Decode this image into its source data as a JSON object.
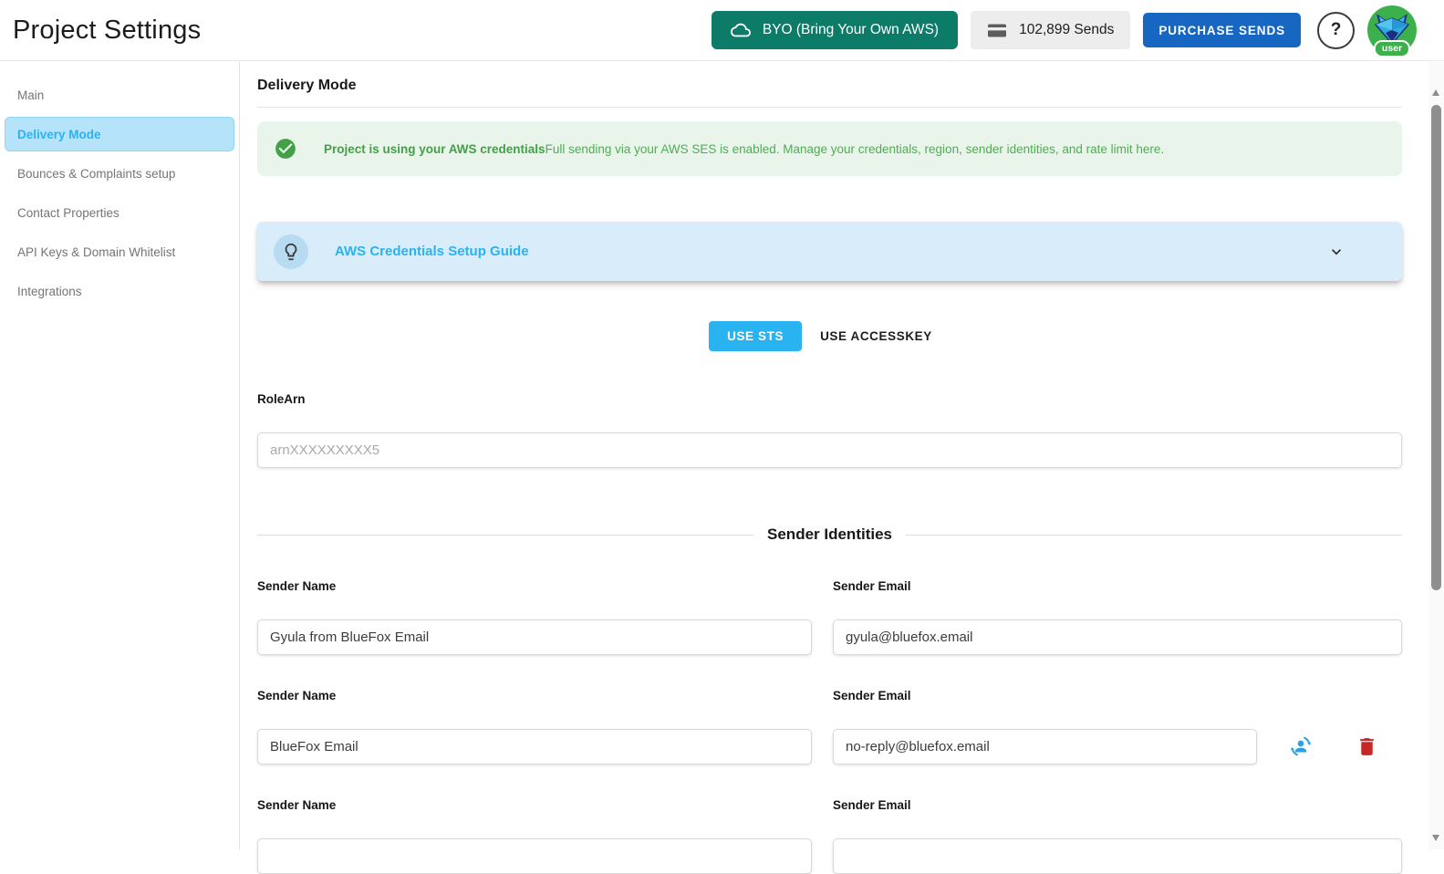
{
  "header": {
    "title": "Project Settings",
    "byo_button": {
      "label": "BYO (Bring Your Own AWS)",
      "icon": "cloud-icon",
      "color": "#0c7b68"
    },
    "sends_chip": {
      "label": "102,899 Sends",
      "icon": "credit-card-icon"
    },
    "purchase_button": {
      "label": "PURCHASE SENDS",
      "color": "#1766c2"
    },
    "help_button": {
      "label": "?"
    },
    "avatar": {
      "icon": "bluefox-logo",
      "badge": "user"
    }
  },
  "sidebar": {
    "items": [
      {
        "label": "Main",
        "active": false
      },
      {
        "label": "Delivery Mode",
        "active": true
      },
      {
        "label": "Bounces & Complaints setup",
        "active": false
      },
      {
        "label": "Contact Properties",
        "active": false
      },
      {
        "label": "API Keys & Domain Whitelist",
        "active": false
      },
      {
        "label": "Integrations",
        "active": false
      }
    ]
  },
  "main": {
    "heading": "Delivery Mode",
    "status_alert": {
      "icon": "check-circle-icon",
      "title": "Project is using your AWS credentials",
      "body": "Full sending via your AWS SES is enabled. Manage your credentials, region, sender identities, and rate limit here.",
      "color": "#4caf50"
    },
    "setup_guide": {
      "icon": "lightbulb-icon",
      "title": "AWS Credentials Setup Guide",
      "chevron": "chevron-down-icon"
    },
    "credential_tabs": [
      {
        "label": "USE STS",
        "active": true
      },
      {
        "label": "USE ACCESSKEY",
        "active": false
      }
    ],
    "role_arn": {
      "label": "RoleArn",
      "value": "",
      "placeholder": "arnXXXXXXXXX5"
    },
    "sender_identities": {
      "heading": "Sender Identities",
      "name_label": "Sender Name",
      "email_label": "Sender Email",
      "rows": [
        {
          "name": "Gyula from BlueFox Email",
          "email": "gyula@bluefox.email"
        },
        {
          "name": "BlueFox Email",
          "email": "no-reply@bluefox.email",
          "actions": [
            "sync-sender-icon",
            "delete-sender-icon"
          ]
        },
        {
          "name": "",
          "email": ""
        }
      ]
    }
  },
  "colors": {
    "accent_blue": "#29b3f1",
    "sidebar_active_bg": "#b5e3f9",
    "success_green": "#4caf50",
    "alert_bg": "#e9f5eb",
    "guide_bg": "#d8ecf9",
    "byo_teal": "#0c7b68",
    "purchase_blue": "#1766c2",
    "delete_red": "#c62828",
    "sync_blue": "#29a3e3"
  }
}
